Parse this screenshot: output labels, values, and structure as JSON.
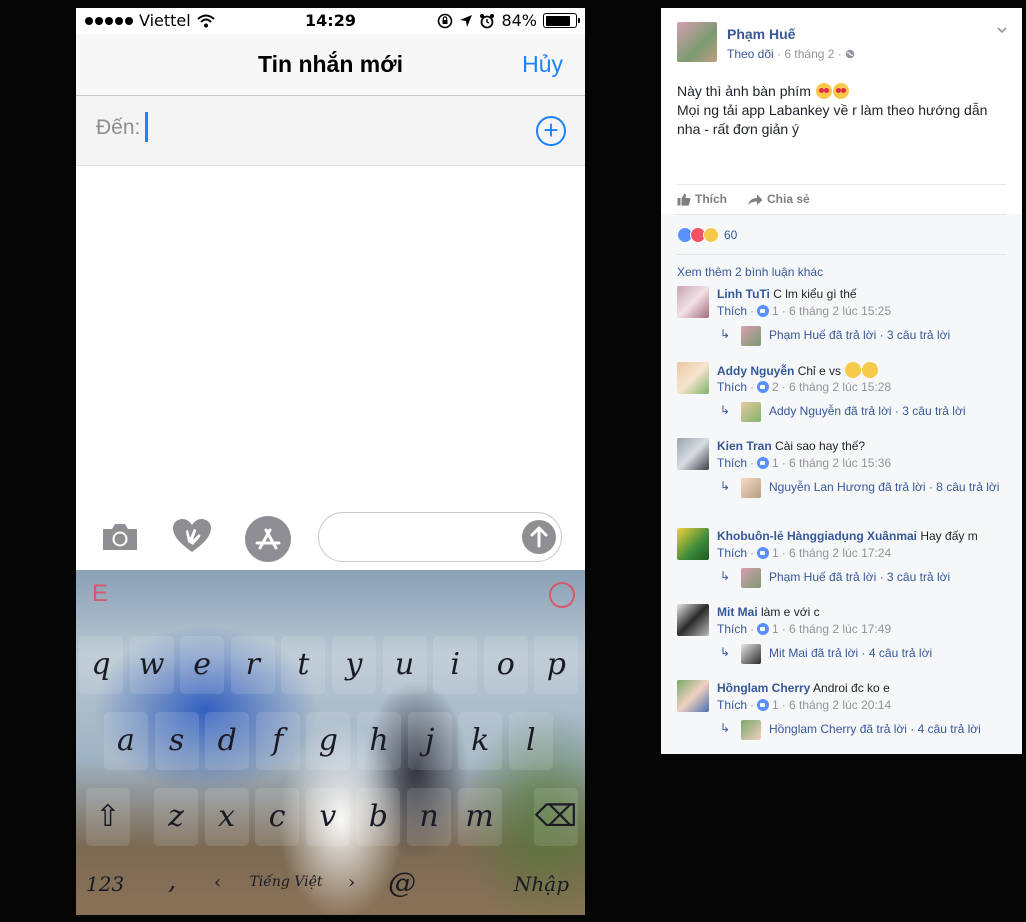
{
  "phone": {
    "status": {
      "carrier": "Viettel",
      "time": "14:29",
      "battery": "84%",
      "battery_level": 0.84
    },
    "nav": {
      "title": "Tin nhắn mới",
      "cancel": "Hủy"
    },
    "to_label": "Đến:",
    "keyboard": {
      "row1": [
        "q",
        "w",
        "e",
        "r",
        "t",
        "y",
        "u",
        "i",
        "o",
        "p"
      ],
      "row2": [
        "a",
        "s",
        "d",
        "f",
        "g",
        "h",
        "j",
        "k",
        "l"
      ],
      "row3": [
        "z",
        "x",
        "c",
        "v",
        "b",
        "n",
        "m"
      ],
      "key_123": "123",
      "key_comma": ",",
      "language": "Tiếng Việt",
      "key_at": "@",
      "key_enter": "Nhập",
      "shift_glyph": "⇧",
      "delete_glyph": "⌫",
      "left_arrow": "‹",
      "right_arrow": "›",
      "topbar_e": "E"
    }
  },
  "post": {
    "author": "Phạm Huế",
    "follow": "Theo dõi",
    "date": "· 6 tháng 2 ·",
    "line1": "Này thì ảnh bàn phím",
    "line2": "Mọi ng tải app Labankey về r làm theo hướng dẫn nha - rất đơn giản ý",
    "like_action": "Thích",
    "share_action": "Chia sẻ",
    "reaction_count": "60",
    "more_comments": "Xem thêm 2 bình luận khác",
    "comments": [
      {
        "name": "Linh TuTi",
        "text": "C lm kiểu gì thế",
        "like": "Thích",
        "likes": "1",
        "time": "· 6 tháng 2 lúc 15:25",
        "reply": "Phạm Huế đã trả lời · 3 câu trả lời"
      },
      {
        "name": "Addy Nguyễn",
        "text": "Chỉ e vs",
        "like": "Thích",
        "likes": "2",
        "time": "· 6 tháng 2 lúc 15:28",
        "reply": "Addy Nguyễn đã trả lời · 3 câu trả lời"
      },
      {
        "name": "Kien Tran",
        "text": "Cài sao hay thế?",
        "like": "Thích",
        "likes": "1",
        "time": "· 6 tháng 2 lúc 15:36",
        "reply": "Nguyễn Lan Hương đã trả lời · 8 câu trả lời"
      },
      {
        "name": "Khobuôn-lẻ Hànggiadụng Xuânmai",
        "text": "Hay đấy m",
        "like": "Thích",
        "likes": "1",
        "time": "· 6 tháng 2 lúc 17:24",
        "reply": "Phạm Huế đã trả lời · 3 câu trả lời"
      },
      {
        "name": "Mit Mai",
        "text": "làm e với c",
        "like": "Thích",
        "likes": "1",
        "time": "· 6 tháng 2 lúc 17:49",
        "reply": "Mit Mai đã trả lời · 4 câu trả lời"
      },
      {
        "name": "Hồnglam Cherry",
        "text": "Androi đc ko e",
        "like": "Thích",
        "likes": "1",
        "time": "· 6 tháng 2 lúc 20:14",
        "reply": "Hồnglam Cherry đã trả lời · 4 câu trả lời"
      }
    ]
  },
  "colors": {
    "ios_blue": "#1a82fb",
    "fb_link": "#365899",
    "fb_meta": "#90949c"
  }
}
